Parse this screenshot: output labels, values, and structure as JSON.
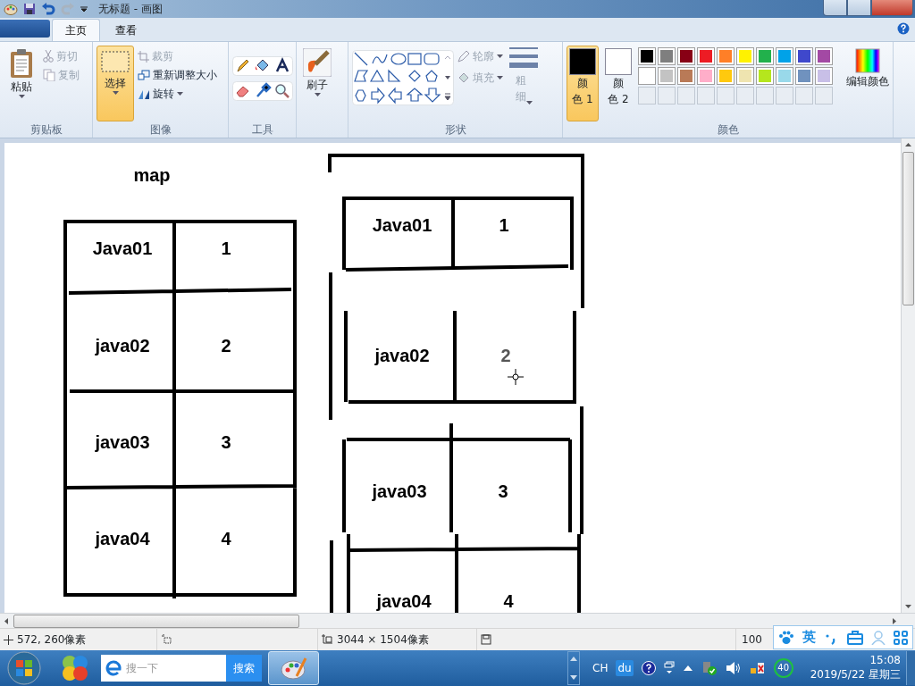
{
  "window": {
    "title": "无标题 - 画图"
  },
  "tabs": [
    {
      "label": "主页",
      "selected": true
    },
    {
      "label": "查看",
      "selected": false
    }
  ],
  "ribbon": {
    "clipboard": {
      "paste": "粘贴",
      "cut": "剪切",
      "copy": "复制",
      "group": "剪贴板"
    },
    "image": {
      "select": "选择",
      "select_on": true,
      "crop": "裁剪",
      "resize": "重新调整大小",
      "rotate": "旋转",
      "group": "图像"
    },
    "tools": {
      "group": "工具"
    },
    "brushes": {
      "label": "刷子"
    },
    "shapes": {
      "outline": "轮廓",
      "fill": "填充",
      "group": "形状"
    },
    "size": {
      "label": "粗细"
    },
    "color1": {
      "lines": [
        "颜",
        "色 1"
      ],
      "selected": true
    },
    "color2": {
      "lines": [
        "颜",
        "色 2"
      ],
      "selected": false
    },
    "palette": [
      {
        "color": "#000000"
      },
      {
        "color": "#7f7f7f"
      },
      {
        "color": "#880015"
      },
      {
        "color": "#ed1c24"
      },
      {
        "color": "#ff7f27"
      },
      {
        "color": "#fff200"
      },
      {
        "color": "#22b14c"
      },
      {
        "color": "#00a2e8"
      },
      {
        "color": "#3f48cc"
      },
      {
        "color": "#a349a4"
      },
      {
        "color": "#ffffff"
      },
      {
        "color": "#c3c3c3"
      },
      {
        "color": "#b97a57"
      },
      {
        "color": "#ffaec9"
      },
      {
        "color": "#ffc90e"
      },
      {
        "color": "#efe4b0"
      },
      {
        "color": "#b5e61d"
      },
      {
        "color": "#99d9ea"
      },
      {
        "color": "#7092be"
      },
      {
        "color": "#c8bfe7"
      }
    ],
    "edit_colors": "编辑颜色",
    "colors_group": "颜色"
  },
  "canvas": {
    "title": "map",
    "left_table": [
      {
        "key": "Java01",
        "value": "1"
      },
      {
        "key": "java02",
        "value": "2"
      },
      {
        "key": "java03",
        "value": "3"
      },
      {
        "key": "java04",
        "value": "4"
      }
    ],
    "right_table": [
      {
        "key": "Java01",
        "value": "1"
      },
      {
        "key": "java02",
        "value": "2"
      },
      {
        "key": "java03",
        "value": "3"
      },
      {
        "key": "java04",
        "value": "4"
      }
    ]
  },
  "status_bar": {
    "cursor": "572, 260像素",
    "size": "3044 × 1504像素",
    "zoom": "100"
  },
  "ime_bar": {
    "mode": "英"
  },
  "taskbar": {
    "search_placeholder": "搜一下",
    "search_button": "搜索",
    "language": "CH",
    "ime": "du",
    "badge": "40",
    "time": "15:08",
    "date": "2019/5/22 星期三"
  }
}
